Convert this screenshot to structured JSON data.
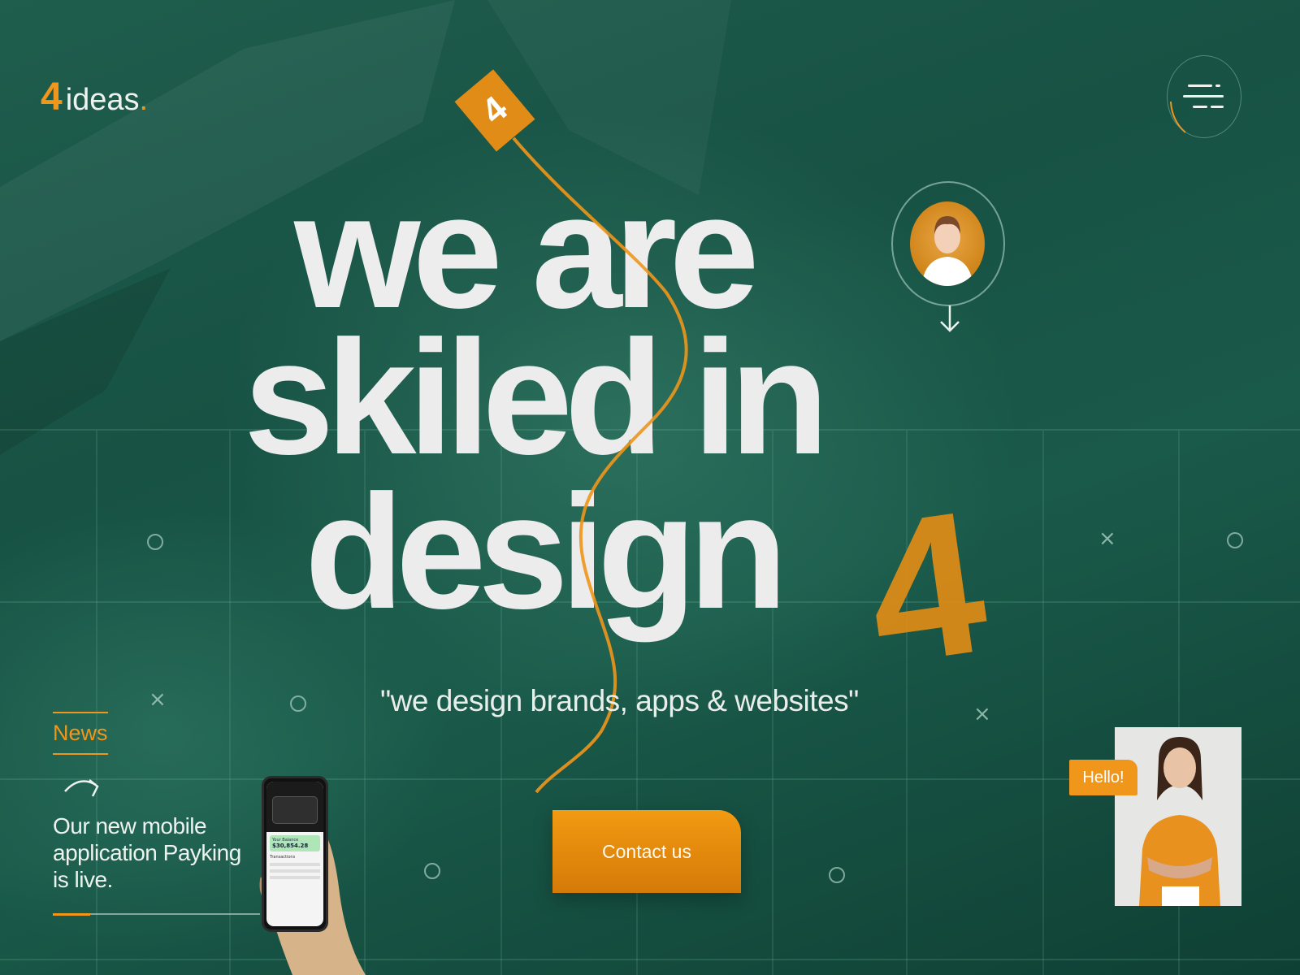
{
  "brand": {
    "logo_digit": "4",
    "logo_text": "ideas",
    "logo_dot": ".",
    "accent_color": "#f0961a",
    "background_color": "#1a5748"
  },
  "nav": {
    "menu_icon": "hamburger-menu-icon"
  },
  "hero": {
    "line1": "we are",
    "line2": "skiled in",
    "line3": "design",
    "accent_numeral": "4",
    "tag_numeral": "4",
    "tagline": "\"we design brands, apps & websites\"",
    "cta_label": "Contact us",
    "scroll_icon": "arrow-down-icon"
  },
  "news": {
    "label": "News",
    "arrow_icon": "curved-arrow-icon",
    "text": "Our new mobile application Payking is live.",
    "progress": 0.18,
    "phone": {
      "card_label": "Your Balance",
      "balance": "$30,854.28",
      "section": "Transactions"
    }
  },
  "testimonial": {
    "bubble": "Hello!"
  }
}
